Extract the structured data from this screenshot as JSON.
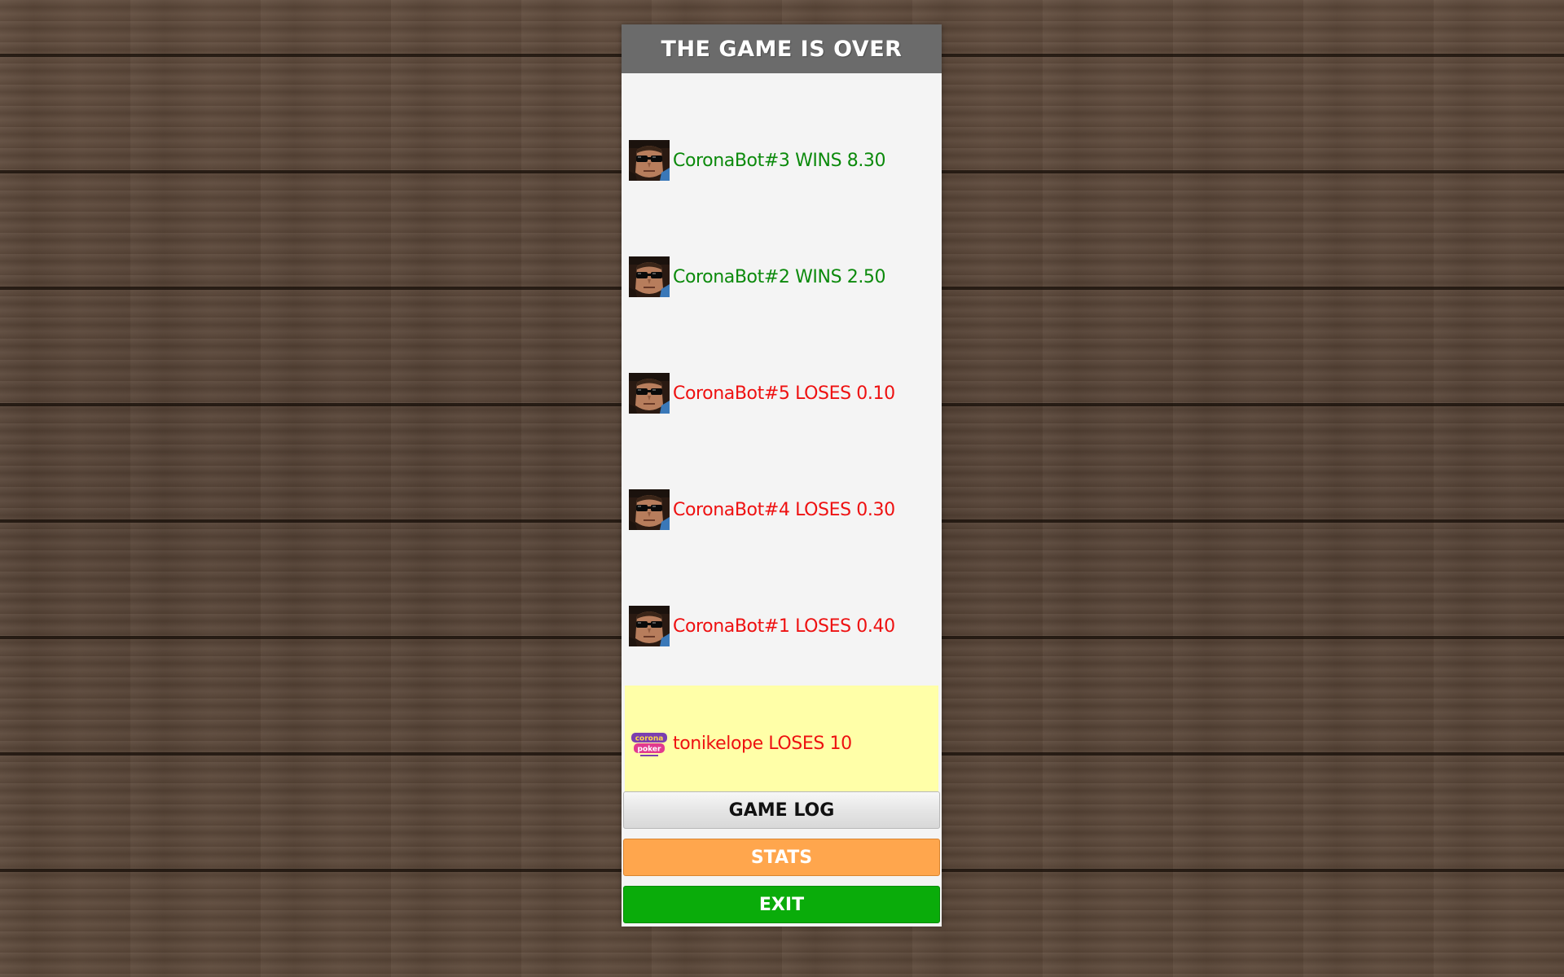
{
  "dialog": {
    "title": "THE GAME IS OVER"
  },
  "results": [
    {
      "text": "CoronaBot#3 WINS 8.30",
      "player": "CoronaBot#3",
      "outcome": "WINS",
      "amount": "8.30",
      "avatar": "bot-avatar",
      "color": "#0c8a0c"
    },
    {
      "text": "CoronaBot#2 WINS 2.50",
      "player": "CoronaBot#2",
      "outcome": "WINS",
      "amount": "2.50",
      "avatar": "bot-avatar",
      "color": "#0c8a0c"
    },
    {
      "text": "CoronaBot#5 LOSES 0.10",
      "player": "CoronaBot#5",
      "outcome": "LOSES",
      "amount": "0.10",
      "avatar": "bot-avatar",
      "color": "#ee1111"
    },
    {
      "text": "CoronaBot#4 LOSES 0.30",
      "player": "CoronaBot#4",
      "outcome": "LOSES",
      "amount": "0.30",
      "avatar": "bot-avatar",
      "color": "#ee1111"
    },
    {
      "text": "CoronaBot#1 LOSES 0.40",
      "player": "CoronaBot#1",
      "outcome": "LOSES",
      "amount": "0.40",
      "avatar": "bot-avatar",
      "color": "#ee1111"
    },
    {
      "text": "tonikelope LOSES 10",
      "player": "tonikelope",
      "outcome": "LOSES",
      "amount": "10",
      "avatar": "corona-poker-logo",
      "color": "#ee1111",
      "highlighted": true
    }
  ],
  "buttons": {
    "game_log": "GAME LOG",
    "stats": "STATS",
    "exit": "EXIT"
  },
  "logo": {
    "line1": "corona",
    "line2": "poker"
  },
  "colors": {
    "win": "#0c8a0c",
    "lose": "#ee1111",
    "header_bg": "#6b6b6b",
    "highlight_row": "#ffffa8",
    "stats_button": "#ffa64d",
    "exit_button": "#0aac0a"
  }
}
